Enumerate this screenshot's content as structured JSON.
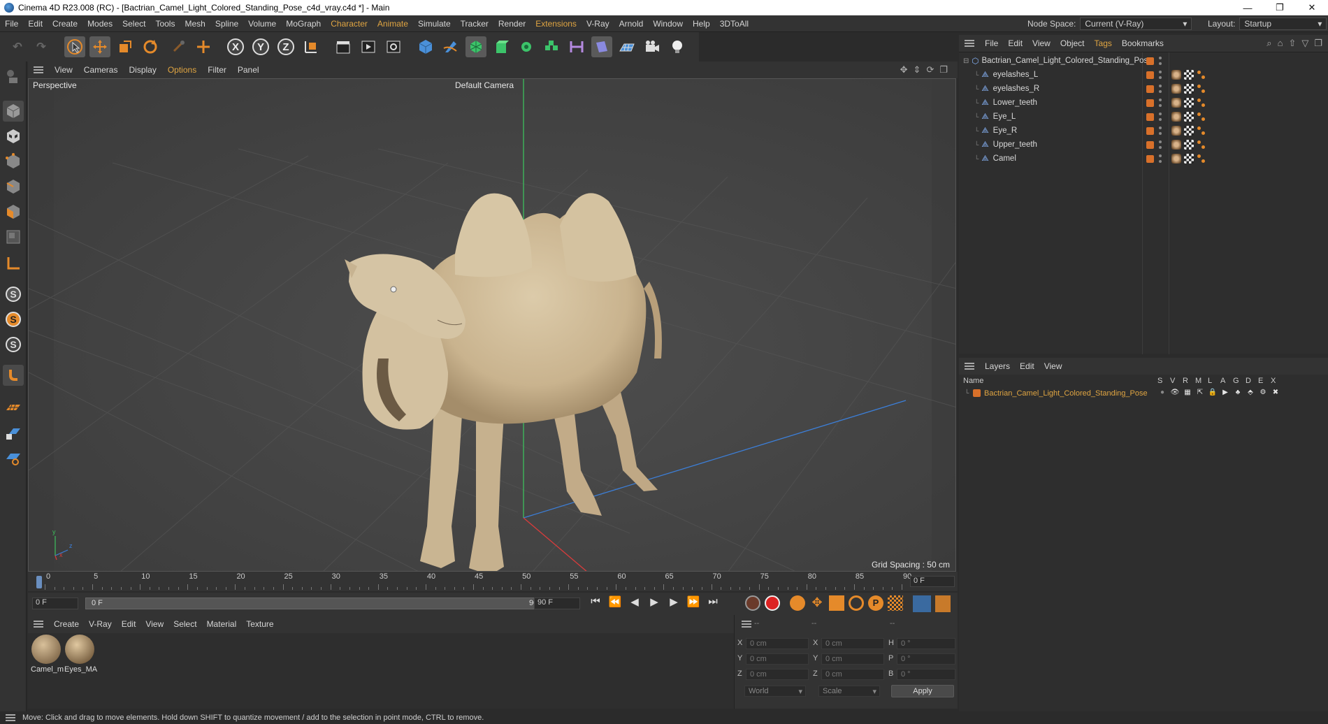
{
  "window": {
    "title": "Cinema 4D R23.008 (RC) - [Bactrian_Camel_Light_Colored_Standing_Pose_c4d_vray.c4d *] - Main",
    "controls": [
      "—",
      "❐",
      "✕"
    ]
  },
  "menubar": {
    "items": [
      "File",
      "Edit",
      "Create",
      "Modes",
      "Select",
      "Tools",
      "Mesh",
      "Spline",
      "Volume",
      "MoGraph",
      "Character",
      "Animate",
      "Simulate",
      "Tracker",
      "Render",
      "Extensions",
      "V-Ray",
      "Arnold",
      "Window",
      "Help",
      "3DToAll"
    ],
    "accent_items": [
      "Character",
      "Animate",
      "Extensions"
    ],
    "node_space_label": "Node Space:",
    "node_space_value": "Current (V-Ray)",
    "layout_label": "Layout:",
    "layout_value": "Startup"
  },
  "toolbar": {
    "axis_labels": [
      "X",
      "Y",
      "Z"
    ]
  },
  "viewport": {
    "menu": [
      "View",
      "Cameras",
      "Display",
      "Options",
      "Filter",
      "Panel"
    ],
    "accent_menu": [
      "Options"
    ],
    "view_name": "Perspective",
    "camera": "Default Camera",
    "grid_spacing": "Grid Spacing : 50 cm",
    "axis_x": "x",
    "axis_y": "y",
    "axis_z": "z"
  },
  "timeline": {
    "ticks": [
      "0",
      "5",
      "10",
      "15",
      "20",
      "25",
      "30",
      "35",
      "40",
      "45",
      "50",
      "55",
      "60",
      "65",
      "70",
      "75",
      "80",
      "85",
      "90"
    ],
    "current_frame": "0 F",
    "start_field": "0 F",
    "range_start": "0 F",
    "range_end": "90 F",
    "end_field": "90 F"
  },
  "materials": {
    "menu": [
      "Create",
      "V-Ray",
      "Edit",
      "View",
      "Select",
      "Material",
      "Texture"
    ],
    "items": [
      {
        "name": "Camel_m"
      },
      {
        "name": "Eyes_MA"
      }
    ]
  },
  "coordinates": {
    "header": [
      "--",
      "--",
      "--"
    ],
    "rows": [
      {
        "l1": "X",
        "v1": "0 cm",
        "l2": "X",
        "v2": "0 cm",
        "l3": "H",
        "v3": "0 °"
      },
      {
        "l1": "Y",
        "v1": "0 cm",
        "l2": "Y",
        "v2": "0 cm",
        "l3": "P",
        "v3": "0 °"
      },
      {
        "l1": "Z",
        "v1": "0 cm",
        "l2": "Z",
        "v2": "0 cm",
        "l3": "B",
        "v3": "0 °"
      }
    ],
    "mode": "World",
    "scale": "Scale",
    "apply": "Apply"
  },
  "object_manager": {
    "menu": [
      "File",
      "Edit",
      "View",
      "Object",
      "Tags",
      "Bookmarks"
    ],
    "accent_menu": [
      "Tags"
    ],
    "root": "Bactrian_Camel_Light_Colored_Standing_Pose",
    "children": [
      "eyelashes_L",
      "eyelashes_R",
      "Lower_teeth",
      "Eye_L",
      "Eye_R",
      "Upper_teeth",
      "Camel"
    ]
  },
  "layers": {
    "menu": [
      "Layers",
      "Edit",
      "View"
    ],
    "col_name": "Name",
    "cols": [
      "S",
      "V",
      "R",
      "M",
      "L",
      "A",
      "G",
      "D",
      "E",
      "X"
    ],
    "layer_name": "Bactrian_Camel_Light_Colored_Standing_Pose",
    "layer_color": "#d8702a"
  },
  "status": {
    "text": "Move: Click and drag to move elements. Hold down SHIFT to quantize movement / add to the selection in point mode, CTRL to remove."
  },
  "colors": {
    "accent": "#e0a542",
    "layer_orange": "#d8702a",
    "camel": "#d6c3a2"
  }
}
